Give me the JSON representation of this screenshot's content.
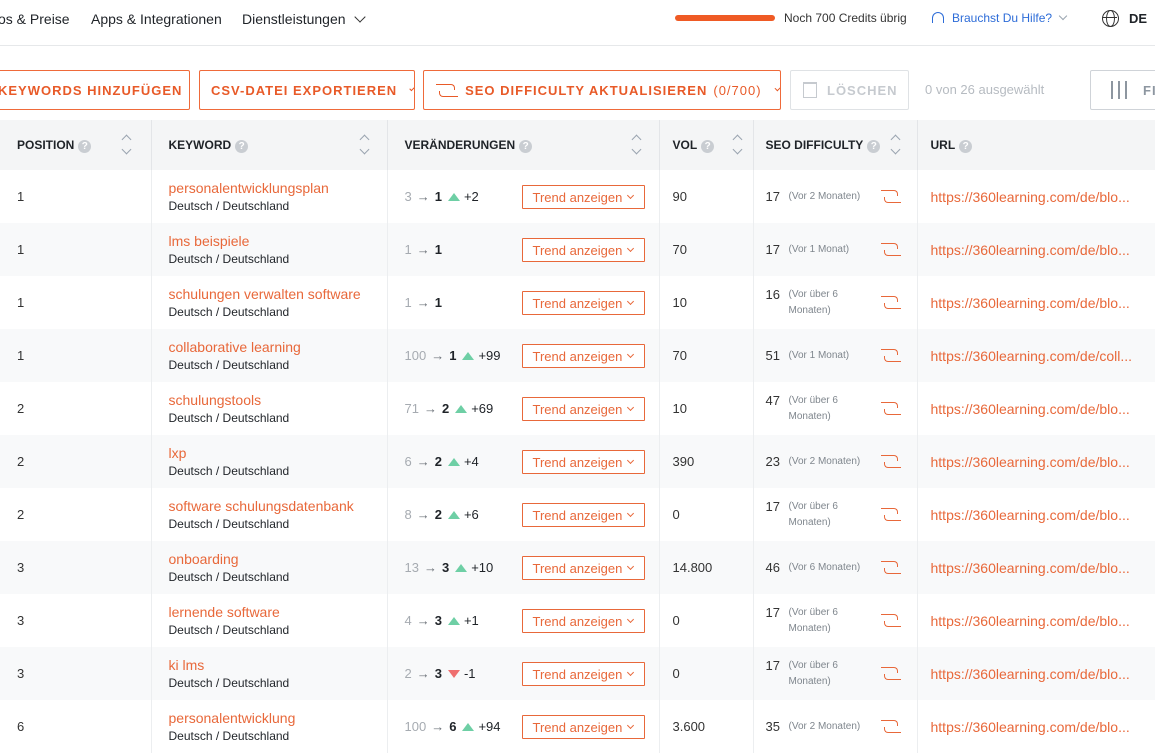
{
  "nav": {
    "links": [
      "os & Preise",
      "Apps & Integrationen",
      "Dienstleistungen"
    ],
    "credits_text": "Noch 700 Credits übrig",
    "help_text": "Brauchst Du Hilfe?",
    "lang": "DE"
  },
  "toolbar": {
    "add_keywords": "KEYWORDS HINZUFÜGEN",
    "export_csv": "CSV-DATEI EXPORTIEREN",
    "update_seo": "SEO DIFFICULTY AKTUALISIEREN",
    "update_seo_count": "(0/700)",
    "delete": "LÖSCHEN",
    "selected": "0 von 26 ausgewählt",
    "filter": "FI"
  },
  "table": {
    "headers": {
      "position": "POSITION",
      "keyword": "KEYWORD",
      "changes": "VERÄNDERUNGEN",
      "vol": "VOL",
      "seo": "SEO DIFFICULTY",
      "url": "URL"
    },
    "help_mark": "?",
    "trend_label": "Trend anzeigen",
    "arrow": "→",
    "rows": [
      {
        "position": "1",
        "keyword": "personalentwicklungsplan",
        "locale": "Deutsch / Deutschland",
        "old": "3",
        "new": "1",
        "dir": "up",
        "delta": "+2",
        "vol": "90",
        "seo": "17",
        "seo_when": "(Vor 2 Monaten)",
        "url": "https://360learning.com/de/blo..."
      },
      {
        "position": "1",
        "keyword": "lms beispiele",
        "locale": "Deutsch / Deutschland",
        "old": "1",
        "new": "1",
        "dir": "none",
        "delta": "",
        "vol": "70",
        "seo": "17",
        "seo_when": "(Vor 1 Monat)",
        "url": "https://360learning.com/de/blo..."
      },
      {
        "position": "1",
        "keyword": "schulungen verwalten software",
        "locale": "Deutsch / Deutschland",
        "old": "1",
        "new": "1",
        "dir": "none",
        "delta": "",
        "vol": "10",
        "seo": "16",
        "seo_when": "(Vor über 6 Monaten)",
        "url": "https://360learning.com/de/blo..."
      },
      {
        "position": "1",
        "keyword": "collaborative learning",
        "locale": "Deutsch / Deutschland",
        "old": "100",
        "new": "1",
        "dir": "up",
        "delta": "+99",
        "vol": "70",
        "seo": "51",
        "seo_when": "(Vor 1 Monat)",
        "url": "https://360learning.com/de/coll..."
      },
      {
        "position": "2",
        "keyword": "schulungstools",
        "locale": "Deutsch / Deutschland",
        "old": "71",
        "new": "2",
        "dir": "up",
        "delta": "+69",
        "vol": "10",
        "seo": "47",
        "seo_when": "(Vor über 6 Monaten)",
        "url": "https://360learning.com/de/blo..."
      },
      {
        "position": "2",
        "keyword": "lxp",
        "locale": "Deutsch / Deutschland",
        "old": "6",
        "new": "2",
        "dir": "up",
        "delta": "+4",
        "vol": "390",
        "seo": "23",
        "seo_when": "(Vor 2 Monaten)",
        "url": "https://360learning.com/de/blo..."
      },
      {
        "position": "2",
        "keyword": "software schulungsdatenbank",
        "locale": "Deutsch / Deutschland",
        "old": "8",
        "new": "2",
        "dir": "up",
        "delta": "+6",
        "vol": "0",
        "seo": "17",
        "seo_when": "(Vor über 6 Monaten)",
        "url": "https://360learning.com/de/blo..."
      },
      {
        "position": "3",
        "keyword": "onboarding",
        "locale": "Deutsch / Deutschland",
        "old": "13",
        "new": "3",
        "dir": "up",
        "delta": "+10",
        "vol": "14.800",
        "seo": "46",
        "seo_when": "(Vor 6 Monaten)",
        "url": "https://360learning.com/de/blo..."
      },
      {
        "position": "3",
        "keyword": "lernende software",
        "locale": "Deutsch / Deutschland",
        "old": "4",
        "new": "3",
        "dir": "up",
        "delta": "+1",
        "vol": "0",
        "seo": "17",
        "seo_when": "(Vor über 6 Monaten)",
        "url": "https://360learning.com/de/blo..."
      },
      {
        "position": "3",
        "keyword": "ki lms",
        "locale": "Deutsch / Deutschland",
        "old": "2",
        "new": "3",
        "dir": "down",
        "delta": "-1",
        "vol": "0",
        "seo": "17",
        "seo_when": "(Vor über 6 Monaten)",
        "url": "https://360learning.com/de/blo..."
      },
      {
        "position": "6",
        "keyword": "personalentwicklung",
        "locale": "Deutsch / Deutschland",
        "old": "100",
        "new": "6",
        "dir": "up",
        "delta": "+94",
        "vol": "3.600",
        "seo": "35",
        "seo_when": "(Vor 2 Monaten)",
        "url": "https://360learning.com/de/blo..."
      }
    ]
  },
  "colors": {
    "accent": "#e8683a",
    "up": "#6ecfa5",
    "down": "#ef6f6f",
    "help_link": "#2d6cd8"
  }
}
